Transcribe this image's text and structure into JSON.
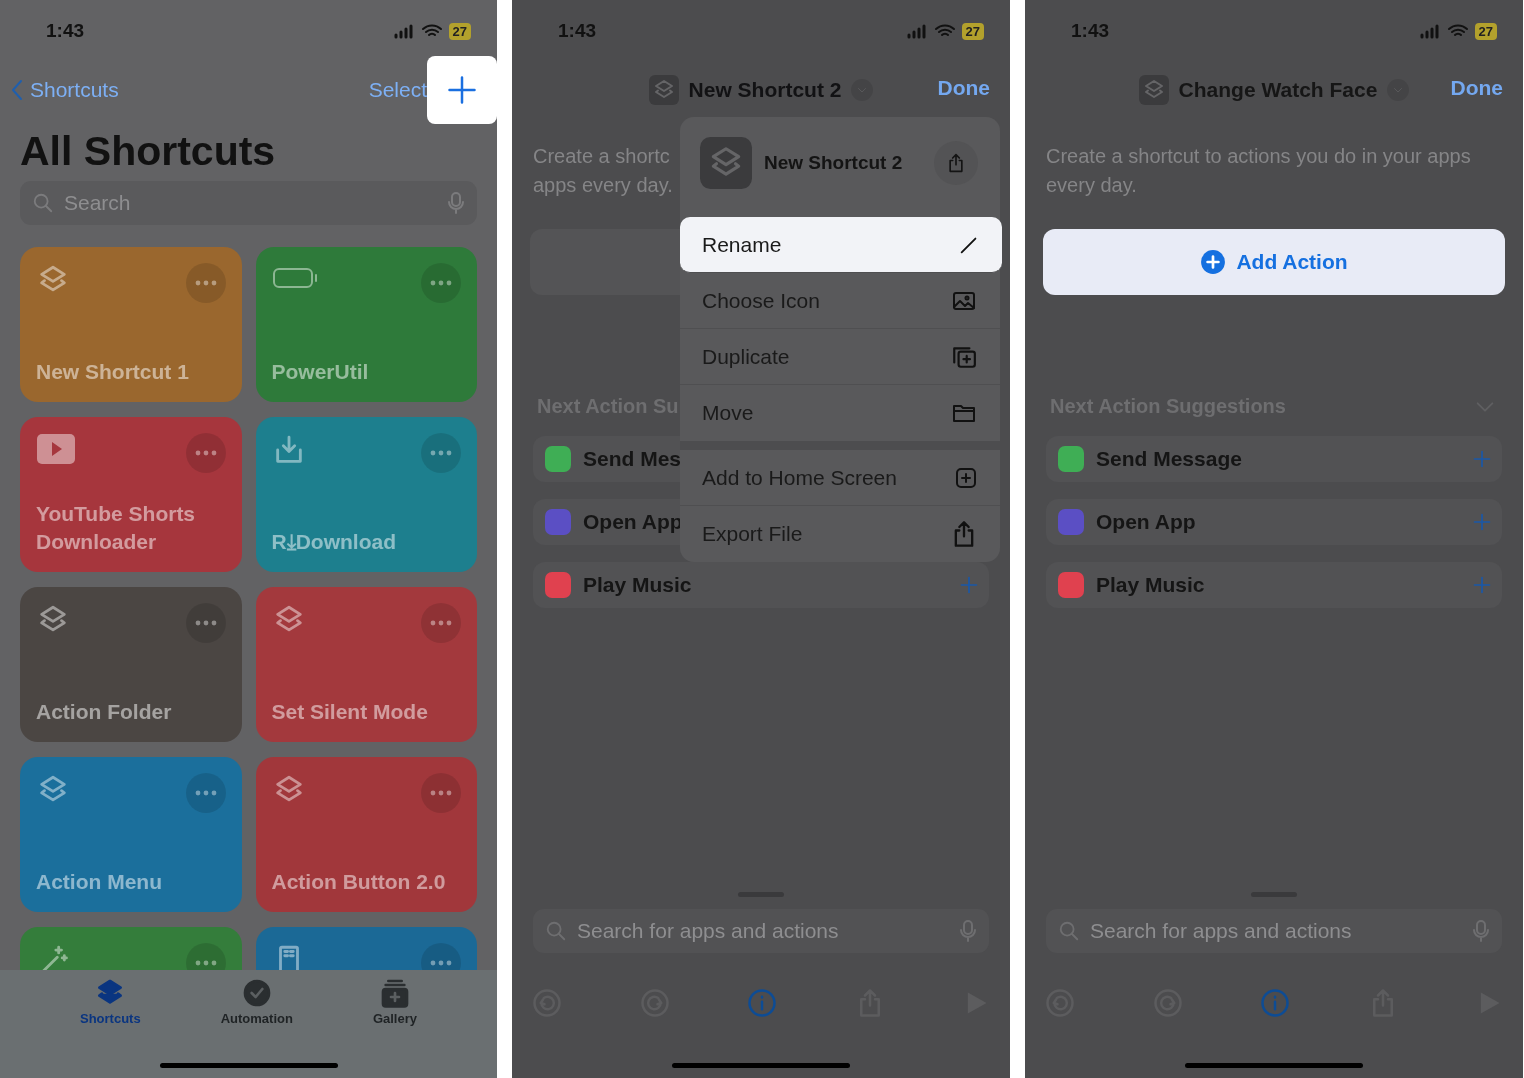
{
  "home_screen": {
    "status_bar": {
      "time": "1:43",
      "battery": "27"
    },
    "back_link": "Shortcuts",
    "select_button": "Select",
    "add_button": {
      "highlighted": true
    },
    "title": "All Shortcuts",
    "search": {
      "placeholder": "Search"
    },
    "shortcuts": [
      {
        "name": "New Shortcut 1",
        "color": "#9a672e"
      },
      {
        "name": "PowerUtil",
        "color": "#2e7a3a"
      },
      {
        "name": "YouTube Shorts Downloader",
        "color": "#a6363d"
      },
      {
        "name": "R⤓Download",
        "color": "#1d7f8e"
      },
      {
        "name": "Action Folder",
        "color": "#4b4643"
      },
      {
        "name": "Set Silent Mode",
        "color": "#a3393d"
      },
      {
        "name": "Action Menu",
        "color": "#1b6f9c"
      },
      {
        "name": "Action Button 2.0",
        "color": "#a1373b"
      },
      {
        "color": "#347d3b"
      },
      {
        "color": "#1b6996"
      }
    ],
    "tabs": [
      {
        "label": "Shortcuts",
        "selected": true
      },
      {
        "label": "Automation",
        "selected": false
      },
      {
        "label": "Gallery",
        "selected": false
      }
    ]
  },
  "menu_screen": {
    "status_bar": {
      "time": "1:43",
      "battery": "27"
    },
    "title": "New Shortcut 2",
    "done": "Done",
    "description_lines": [
      "Create a shortc",
      "apps every day."
    ],
    "section_title": "Next Action Su",
    "suggestions": [
      {
        "label": "Send Mes",
        "color": "#3fae55"
      },
      {
        "label": "Open App",
        "color": "#5b4fc4"
      },
      {
        "label": "Play Music",
        "color": "#e0414f",
        "add_button": true
      }
    ],
    "search": {
      "placeholder": "Search for apps and actions"
    },
    "menu": {
      "title": "New Shortcut 2",
      "sections": [
        {
          "items": [
            {
              "label": "Rename",
              "selected": true
            },
            {
              "label": "Choose Icon",
              "selected": false
            },
            {
              "label": "Duplicate",
              "selected": false
            },
            {
              "label": "Move",
              "selected": false
            }
          ]
        },
        {
          "items": [
            {
              "label": "Add to Home Screen",
              "selected": false
            },
            {
              "label": "Export File",
              "selected": false
            }
          ]
        }
      ]
    }
  },
  "editor_screen": {
    "status_bar": {
      "time": "1:43",
      "battery": "27"
    },
    "title": "Change Watch Face",
    "done": "Done",
    "description": "Create a shortcut to actions you do in your apps every day.",
    "add_action": {
      "label": "Add Action",
      "highlighted": true
    },
    "section_title": "Next Action Suggestions",
    "suggestions": [
      {
        "label": "Send Message",
        "color": "#3fae55",
        "add_button": true
      },
      {
        "label": "Open App",
        "color": "#5b4fc4",
        "add_button": true
      },
      {
        "label": "Play Music",
        "color": "#e0414f",
        "add_button": true
      }
    ],
    "search": {
      "placeholder": "Search for apps and actions"
    }
  }
}
